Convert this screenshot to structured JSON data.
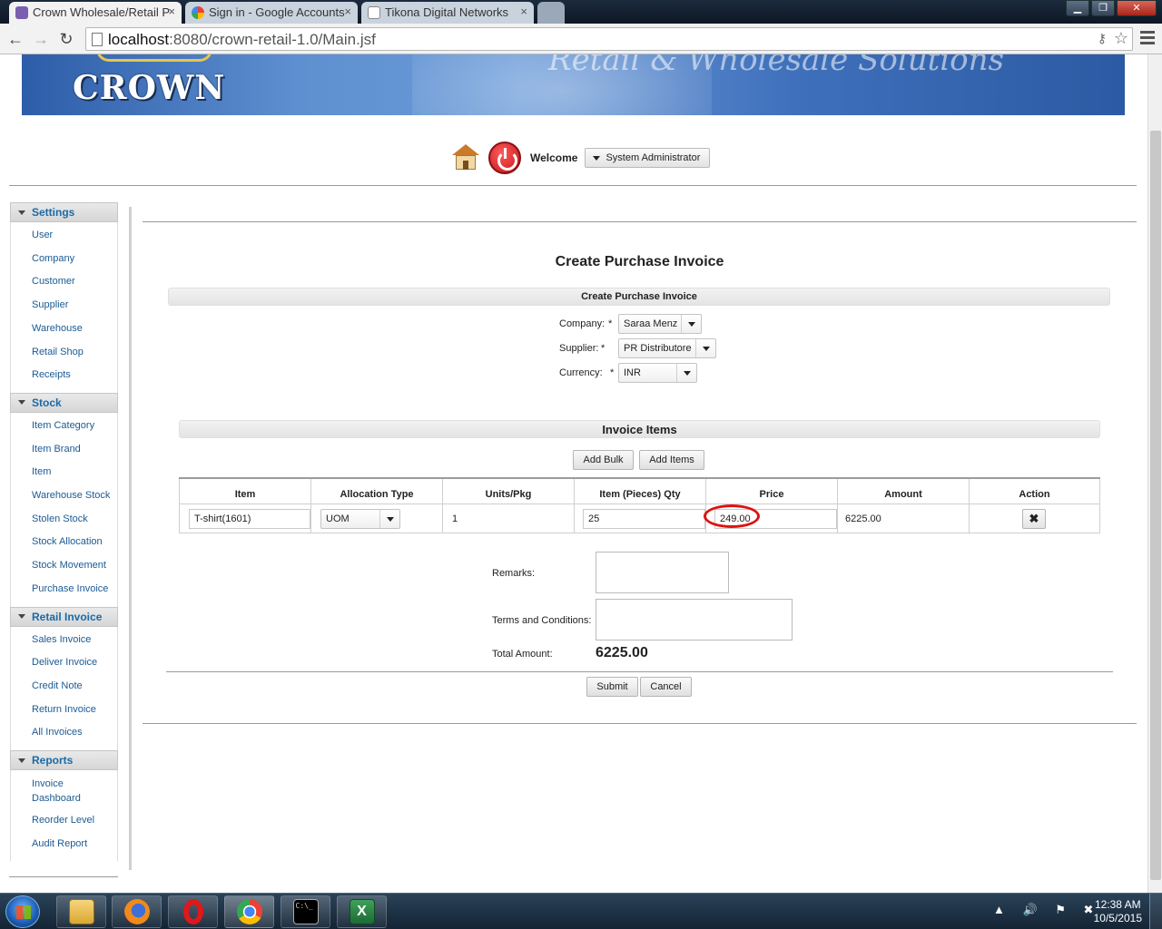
{
  "browser": {
    "tabs": [
      {
        "title": "Crown Wholesale/Retail P",
        "close": "×"
      },
      {
        "title": "Sign in - Google Accounts",
        "close": "×"
      },
      {
        "title": "Tikona Digital Networks",
        "close": "×"
      }
    ],
    "url_host": "localhost",
    "url_rest": ":8080/crown-retail-1.0/Main.jsf",
    "window_buttons": {
      "minimize": "▁",
      "maximize": "❐",
      "close": "✕"
    }
  },
  "header": {
    "logo": "CROWN",
    "tagline": "Retail & Wholesale Solutions",
    "welcome_label": "Welcome",
    "user_menu": "System Administrator"
  },
  "sidebar": {
    "panels": [
      {
        "title": "Settings",
        "items": [
          "User",
          "Company",
          "Customer",
          "Supplier",
          "Warehouse",
          "Retail Shop",
          "Receipts"
        ]
      },
      {
        "title": "Stock",
        "items": [
          "Item Category",
          "Item Brand",
          "Item",
          "Warehouse Stock",
          "Stolen Stock",
          "Stock Allocation",
          "Stock Movement",
          "Purchase Invoice"
        ]
      },
      {
        "title": "Retail Invoice",
        "items": [
          "Sales Invoice",
          "Deliver Invoice",
          "Credit Note",
          "Return Invoice",
          "All Invoices"
        ]
      },
      {
        "title": "Reports",
        "items": [
          "Invoice Dashboard",
          "Reorder Level",
          "Audit Report"
        ]
      }
    ]
  },
  "main": {
    "page_title": "Create Purchase Invoice",
    "form_section_title": "Create Purchase Invoice",
    "fields": {
      "company": {
        "label": "Company:",
        "required": "*",
        "value": "Saraa Menz"
      },
      "supplier": {
        "label": "Supplier:",
        "required": "*",
        "value": "PR Distributore"
      },
      "currency": {
        "label": "Currency:",
        "required": "*",
        "value": "INR"
      }
    },
    "items_section_title": "Invoice Items",
    "add_bulk_label": "Add Bulk",
    "add_items_label": "Add Items",
    "table": {
      "columns": [
        "Item",
        "Allocation Type",
        "Units/Pkg",
        "Item (Pieces) Qty",
        "Price",
        "Amount",
        "Action"
      ],
      "rows": [
        {
          "item": "T-shirt(1601)",
          "allocation_type": "UOM",
          "units_pkg": "1",
          "qty": "25",
          "price": "249.00",
          "amount": "6225.00",
          "action_icon": "✖"
        }
      ]
    },
    "remarks_label": "Remarks:",
    "terms_label": "Terms and Conditions:",
    "total_label": "Total Amount:",
    "total_value": "6225.00",
    "submit_label": "Submit",
    "cancel_label": "Cancel"
  },
  "taskbar": {
    "clock_time": "12:38 AM",
    "clock_date": "10/5/2015",
    "tray_icons": "▲ 🔊 ⚑ ✖"
  },
  "colors": {
    "link": "#1b5a94",
    "panel_header_text": "#1b6aa6",
    "annotation": "#e01111"
  }
}
